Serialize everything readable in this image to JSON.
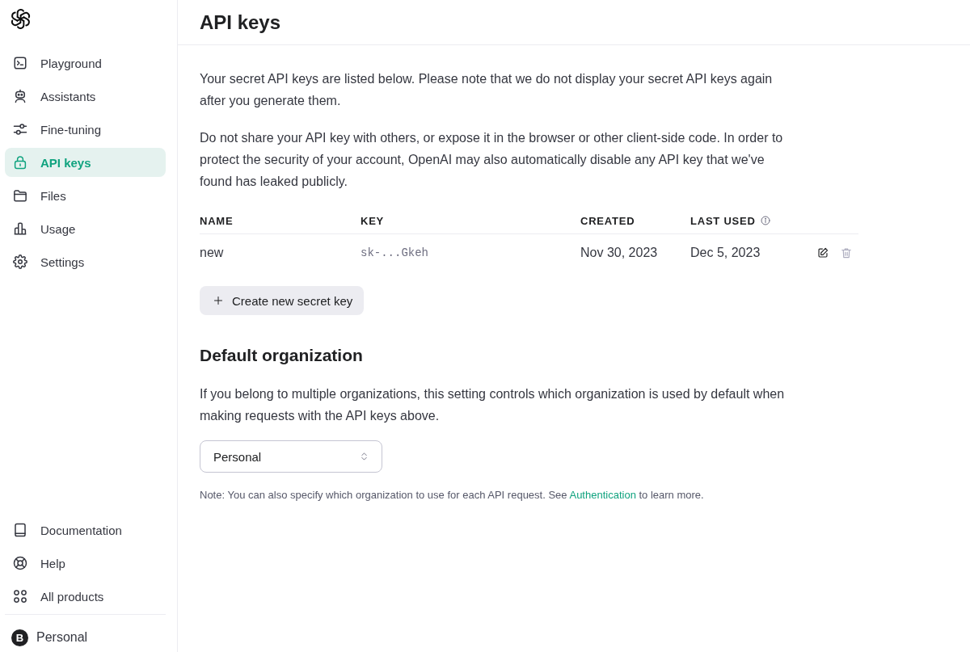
{
  "sidebar": {
    "nav_items": [
      {
        "label": "Playground",
        "selected": false
      },
      {
        "label": "Assistants",
        "selected": false
      },
      {
        "label": "Fine-tuning",
        "selected": false
      },
      {
        "label": "API keys",
        "selected": true
      },
      {
        "label": "Files",
        "selected": false
      },
      {
        "label": "Usage",
        "selected": false
      },
      {
        "label": "Settings",
        "selected": false
      }
    ],
    "footer_items": [
      {
        "label": "Documentation"
      },
      {
        "label": "Help"
      },
      {
        "label": "All products"
      }
    ],
    "account": {
      "initial": "B",
      "name": "Personal"
    }
  },
  "header": {
    "title": "API keys"
  },
  "intro": [
    "Your secret API keys are listed below. Please note that we do not display your secret API keys again after you generate them.",
    "Do not share your API key with others, or expose it in the browser or other client-side code. In order to protect the security of your account, OpenAI may also automatically disable any API key that we've found has leaked publicly."
  ],
  "keys_table": {
    "columns": [
      "NAME",
      "KEY",
      "CREATED",
      "LAST USED"
    ],
    "rows": [
      {
        "name": "new",
        "key": "sk-...Gkeh",
        "created": "Nov 30, 2023",
        "last_used": "Dec 5, 2023"
      }
    ]
  },
  "create_button": {
    "label": "Create new secret key"
  },
  "default_organization": {
    "title": "Default organization",
    "description": "If you belong to multiple organizations, this setting controls which organization is used by default when making requests with the API keys above.",
    "select": {
      "value": "Personal"
    },
    "note": {
      "before": "Note: You can also specify which organization to use for each API request. See ",
      "link": "Authentication",
      "after": " to learn more."
    }
  }
}
